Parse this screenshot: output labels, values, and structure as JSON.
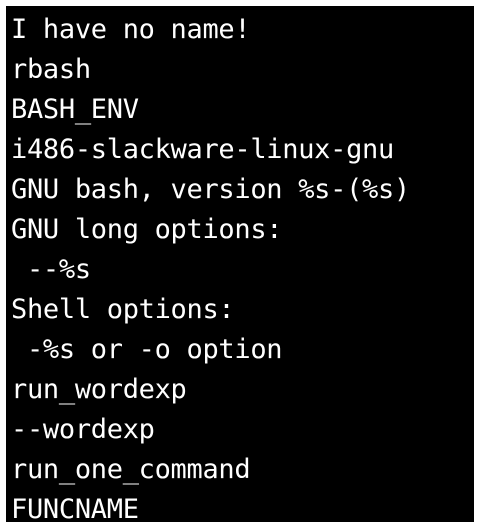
{
  "terminal": {
    "background": "#000000",
    "foreground": "#ffffff",
    "lines": [
      "I have no name!",
      "rbash",
      "BASH_ENV",
      "i486-slackware-linux-gnu",
      "GNU bash, version %s-(%s)",
      "GNU long options:",
      " --%s",
      "Shell options:",
      " -%s or -o option",
      "run_wordexp",
      "--wordexp",
      "run_one_command",
      "FUNCNAME"
    ]
  }
}
